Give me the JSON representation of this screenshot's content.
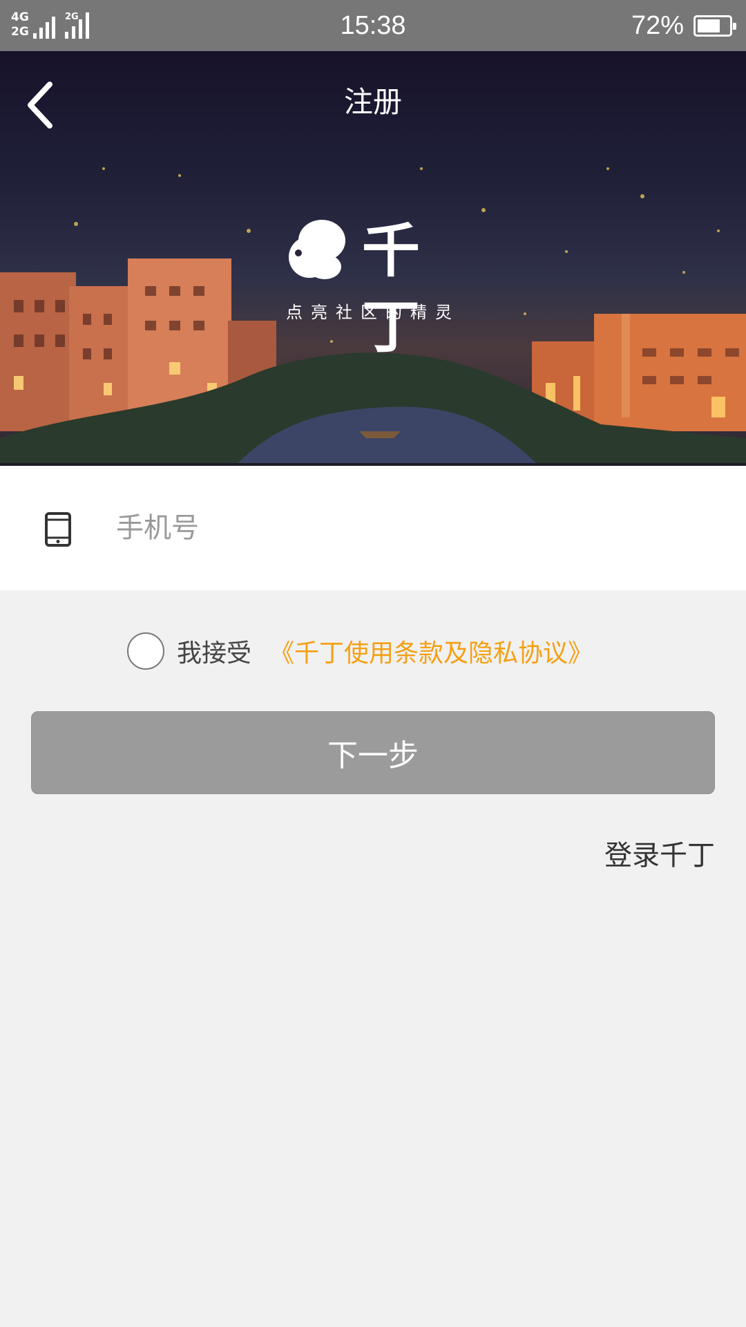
{
  "status_bar": {
    "network_top": "4G",
    "network_bottom": "2G",
    "network_secondary": "2G",
    "time": "15:38",
    "battery_percent": "72%",
    "battery_level": 0.72
  },
  "header": {
    "title": "注册",
    "brand_name": "千丁",
    "slogan": "点亮社区的精灵"
  },
  "form": {
    "phone_placeholder": "手机号",
    "phone_value": "",
    "agree_prefix": "我接受",
    "agree_link": "《千丁使用条款及隐私协议》",
    "agree_checked": false,
    "next_button": "下一步",
    "login_link": "登录千丁"
  },
  "colors": {
    "status_bar": "#777777",
    "link_accent": "#f5a014",
    "button_disabled": "#9b9b9b",
    "page_bg": "#f1f1f1"
  }
}
